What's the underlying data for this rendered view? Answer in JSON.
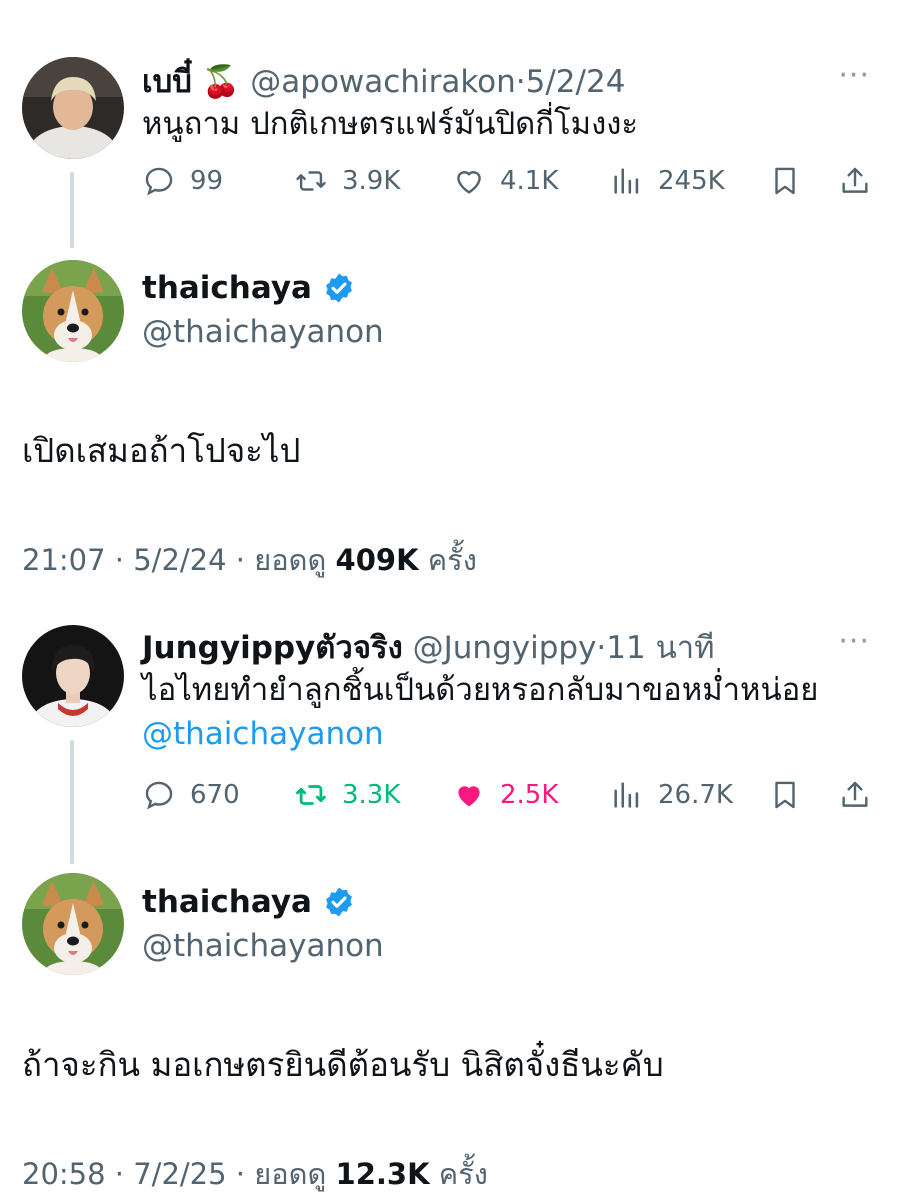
{
  "thread1": {
    "reply": {
      "name": "เบบี๋",
      "emoji": "🍒",
      "handle": "@apowachirakon",
      "date": "5/2/24",
      "text": "หนูถาม ปกติเกษตรแฟร์มันปิดกี่โมงงะ",
      "comments": "99",
      "reposts": "3.9K",
      "likes": "4.1K",
      "views": "245K"
    },
    "main": {
      "name": "thaichaya",
      "handle": "@thaichayanon",
      "text": "เปิดเสมอถ้าโปจะไป",
      "time": "21:07",
      "date": "5/2/24",
      "views_label": "ยอดดู",
      "views": "409K",
      "views_suffix": "ครั้ง"
    }
  },
  "thread2": {
    "reply": {
      "name": "Jungyippyตัวจริง",
      "handle": "@Jungyippy",
      "date": "11 นาที",
      "text": "ไอไทยทำยำลูกชิ้นเป็นด้วยหรอกลับมาขอหม่ำหน่อย",
      "mention": "@thaichayanon",
      "comments": "670",
      "reposts": "3.3K",
      "likes": "2.5K",
      "views": "26.7K"
    },
    "main": {
      "name": "thaichaya",
      "handle": "@thaichayanon",
      "text": "ถ้าจะกิน มอเกษตรยินดีต้อนรับ นิสิตจั๋งธีนะคับ",
      "time": "20:58",
      "date": "7/2/25",
      "views_label": "ยอดดู",
      "views": "12.3K",
      "views_suffix": "ครั้ง"
    }
  },
  "icons": {
    "comment": "comment-icon",
    "repost": "repost-icon",
    "like": "heart-icon",
    "views": "views-icon",
    "bookmark": "bookmark-icon",
    "share": "share-icon",
    "verified": "verified-badge-icon",
    "more": "more-icon"
  },
  "colors": {
    "text": "#0f1419",
    "muted": "#536471",
    "link": "#1d9bf0",
    "repost_active": "#00ba7c",
    "like_active": "#f91880",
    "verified": "#1d9bf0",
    "thread_line": "#cfd9de"
  },
  "more_label": "···",
  "separator": "·"
}
